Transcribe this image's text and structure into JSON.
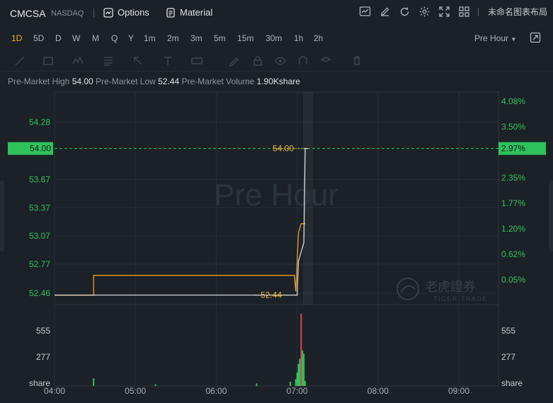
{
  "header": {
    "symbol": "CMCSA",
    "exchange": "NASDAQ",
    "options_label": "Options",
    "material_label": "Material",
    "layout_label": "未命名图表布局",
    "icons": [
      "chart-icon",
      "edit-icon",
      "refresh-icon",
      "settings-icon",
      "fullscreen-icon",
      "grid-icon"
    ]
  },
  "periods": [
    "1D",
    "5D",
    "D",
    "W",
    "M",
    "Q",
    "Y",
    "1m",
    "2m",
    "3m",
    "5m",
    "15m",
    "30m",
    "1h",
    "2h"
  ],
  "active_period": "1D",
  "session_select": "Pre Hour",
  "info": {
    "high_label": "Pre-Market High",
    "high_value": "54.00",
    "low_label": "Pre-Market Low",
    "low_value": "52.44",
    "volume_label": "Pre-Market Volume",
    "volume_value": "1.90Kshare"
  },
  "colors": {
    "background": "#1b2127",
    "price_line": "#f0a020",
    "avg_line": "#e8e8e8",
    "green": "#2fc25b",
    "red": "#e0454d",
    "yellow": "#e9b52a"
  },
  "watermark": "Pre Hour",
  "logo_text": "老虎證券",
  "logo_sub": "TIGER TRADE",
  "chart_data": {
    "type": "line",
    "y_left_ticks": [
      "54.28",
      "53.98",
      "53.67",
      "53.37",
      "53.07",
      "52.77",
      "52.46"
    ],
    "y_left_values": [
      54.28,
      53.98,
      53.67,
      53.37,
      53.07,
      52.77,
      52.46
    ],
    "y_right_ticks": [
      "4.08%",
      "3.50%",
      "2.97%",
      "2.35%",
      "1.77%",
      "1.20%",
      "0.62%",
      "0.05%"
    ],
    "current_price_label": "54.00",
    "current_pct_label": "2.97%",
    "high_marker": "54.00",
    "low_marker": "52.44",
    "x_ticks": [
      "04:00",
      "05:00",
      "06:00",
      "07:00",
      "08:00",
      "09:00"
    ],
    "ylim": [
      52.34,
      54.6
    ],
    "price_series": {
      "name": "price",
      "points": [
        [
          "04:00",
          52.44
        ],
        [
          "04:29",
          52.44
        ],
        [
          "04:29",
          52.65
        ],
        [
          "06:58",
          52.65
        ],
        [
          "06:59",
          52.48
        ],
        [
          "07:01",
          53.1
        ],
        [
          "07:03",
          53.2
        ],
        [
          "07:06",
          53.2
        ]
      ]
    },
    "avg_series": {
      "name": "avg",
      "points": [
        [
          "04:00",
          52.44
        ],
        [
          "07:00",
          52.44
        ],
        [
          "07:01",
          52.8
        ],
        [
          "07:05",
          53.0
        ],
        [
          "07:06",
          54.0
        ],
        [
          "07:08",
          54.0
        ]
      ]
    },
    "volume": {
      "labels": [
        "555",
        "277",
        "share"
      ],
      "values": [
        555,
        277
      ],
      "bars": [
        [
          "04:29",
          90,
          "green"
        ],
        [
          "05:15",
          20,
          "green"
        ],
        [
          "06:30",
          30,
          "green"
        ],
        [
          "06:55",
          50,
          "green"
        ],
        [
          "06:59",
          80,
          "green"
        ],
        [
          "07:00",
          160,
          "green"
        ],
        [
          "07:01",
          260,
          "green"
        ],
        [
          "07:02",
          320,
          "green"
        ],
        [
          "07:03",
          850,
          "red"
        ],
        [
          "07:04",
          420,
          "green"
        ],
        [
          "07:05",
          380,
          "green"
        ],
        [
          "07:06",
          60,
          "green"
        ]
      ]
    }
  }
}
